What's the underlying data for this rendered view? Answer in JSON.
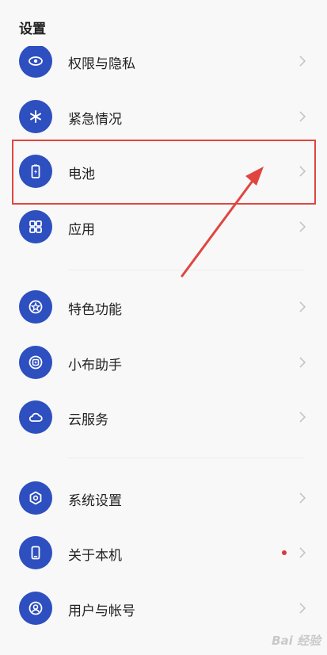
{
  "header": {
    "title": "设置"
  },
  "rows": [
    {
      "label": "权限与隐私",
      "icon": "eye-lock-icon"
    },
    {
      "label": "紧急情况",
      "icon": "asterisk-icon"
    },
    {
      "label": "电池",
      "icon": "battery-icon"
    },
    {
      "label": "应用",
      "icon": "grid-apps-icon"
    },
    {
      "label": "特色功能",
      "icon": "star-badge-icon"
    },
    {
      "label": "小布助手",
      "icon": "assistant-icon"
    },
    {
      "label": "云服务",
      "icon": "cloud-icon"
    },
    {
      "label": "系统设置",
      "icon": "hexagon-gear-icon"
    },
    {
      "label": "关于本机",
      "icon": "phone-icon",
      "badge": true
    },
    {
      "label": "用户与帐号",
      "icon": "user-icon"
    }
  ],
  "colors": {
    "icon_bg": "#2d4fbf",
    "highlight": "#e0463f",
    "badge": "#d93a3a"
  },
  "watermark": "Bai 经验"
}
